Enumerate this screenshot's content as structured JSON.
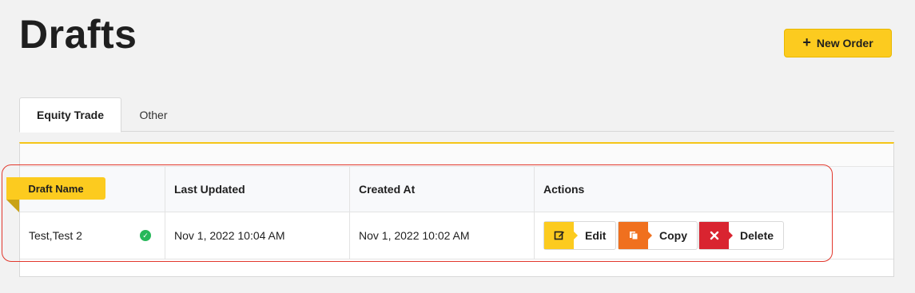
{
  "page": {
    "title": "Drafts"
  },
  "toolbar": {
    "new_order_label": "New Order"
  },
  "tabs": [
    {
      "label": "Equity Trade",
      "active": true
    },
    {
      "label": "Other",
      "active": false
    }
  ],
  "table": {
    "columns": [
      "Draft Name",
      "Last Updated",
      "Created At",
      "Actions"
    ],
    "rows": [
      {
        "draft_name": "Test,Test 2",
        "status": "valid",
        "last_updated": "Nov 1, 2022 10:04 AM",
        "created_at": "Nov 1, 2022 10:02 AM"
      }
    ]
  },
  "actions": {
    "edit_label": "Edit",
    "copy_label": "Copy",
    "delete_label": "Delete"
  },
  "colors": {
    "accent": "#fccb1f",
    "copy": "#f0701e",
    "delete": "#d92430",
    "success": "#27b85a",
    "highlight": "#e2382d"
  },
  "icons": {
    "new_order": "plus-icon",
    "status": "check-circle-icon",
    "edit": "edit-icon",
    "copy": "copy-icon",
    "delete": "close-icon"
  }
}
